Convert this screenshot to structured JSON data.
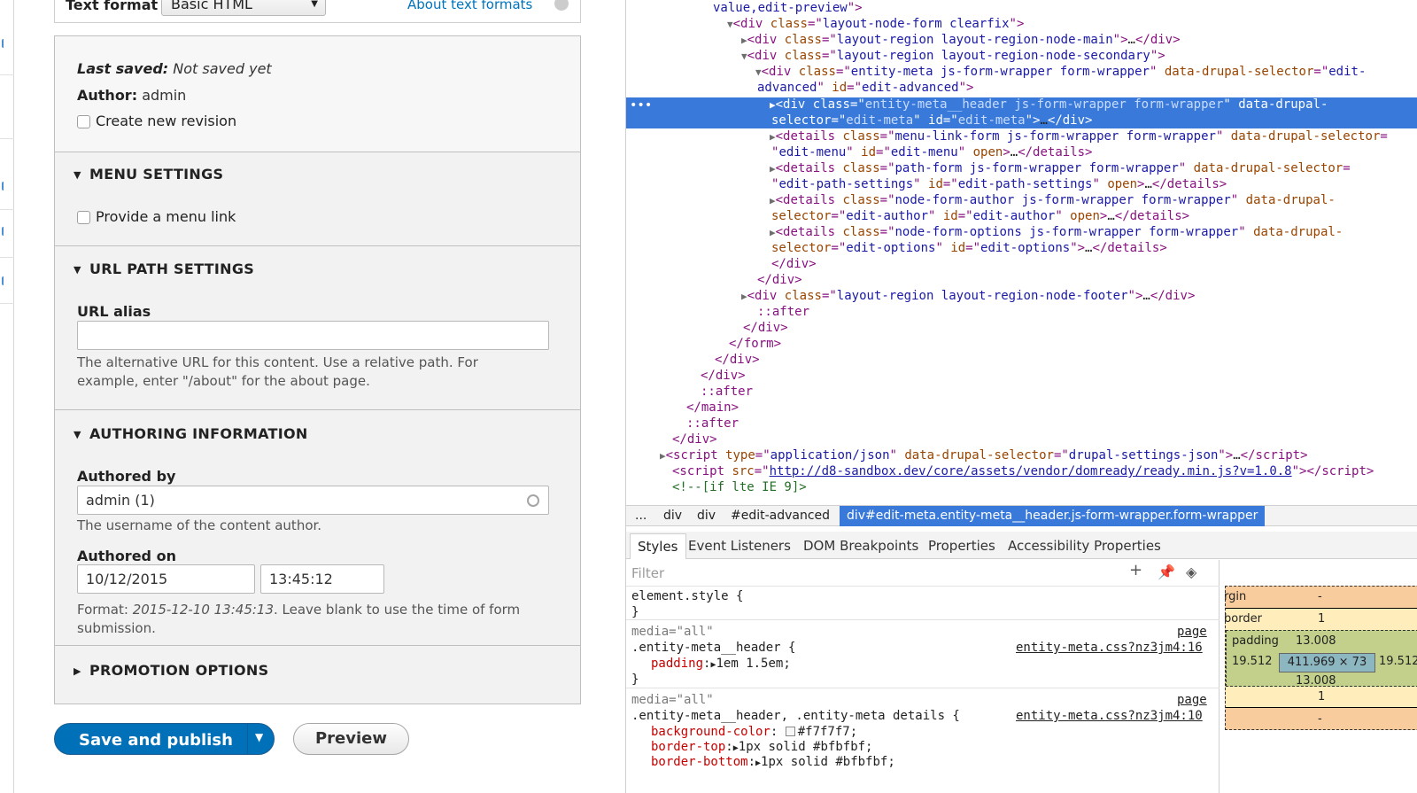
{
  "drupal": {
    "text_format": {
      "label": "Text format",
      "value": "Basic HTML",
      "help_link": "About text formats"
    },
    "meta": {
      "last_saved_label": "Last saved:",
      "last_saved_value": "Not saved yet",
      "author_label": "Author:",
      "author_value": "admin",
      "revision_checkbox": "Create new revision"
    },
    "menu_settings": {
      "title": "MENU SETTINGS",
      "checkbox": "Provide a menu link"
    },
    "url_path": {
      "title": "URL PATH SETTINGS",
      "field_label": "URL alias",
      "value": "",
      "desc_line1": "The alternative URL for this content. Use a relative path. For",
      "desc_line2": "example, enter \"/about\" for the about page."
    },
    "authoring": {
      "title": "AUTHORING INFORMATION",
      "authored_by_label": "Authored by",
      "authored_by_value": "admin (1)",
      "authored_by_desc": "The username of the content author.",
      "authored_on_label": "Authored on",
      "date_value": "10/12/2015",
      "time_value": "13:45:12",
      "format_prefix": "Format: ",
      "format_example": "2015-12-10 13:45:13",
      "format_suffix": ". Leave blank to use the time of form",
      "format_line2": "submission."
    },
    "promotion": {
      "title": "PROMOTION OPTIONS"
    },
    "actions": {
      "save": "Save and publish",
      "preview": "Preview"
    }
  },
  "devtools": {
    "breadcrumbs": [
      "...",
      "div",
      "div",
      "#edit-advanced"
    ],
    "breadcrumb_active": "div#edit-meta.entity-meta__header.js-form-wrapper.form-wrapper",
    "tabs": [
      "Styles",
      "Event Listeners",
      "DOM Breakpoints",
      "Properties",
      "Accessibility Properties"
    ],
    "filter_placeholder": "Filter",
    "rules": [
      {
        "media": "",
        "selector": "element.style {",
        "source": "",
        "props": []
      },
      {
        "media": "media=\"all\"",
        "selector": ".entity-meta__header {",
        "source_top": "page",
        "source": "entity-meta.css?nz3jm4:16",
        "props": [
          {
            "name": "padding",
            "value": "1em 1.5em;"
          }
        ]
      },
      {
        "media": "media=\"all\"",
        "selector": ".entity-meta__header, .entity-meta details {",
        "source_top": "page",
        "source": "entity-meta.css?nz3jm4:10",
        "props": [
          {
            "name": "background-color",
            "value": "#f7f7f7;"
          },
          {
            "name": "border-top",
            "value": "1px solid #bfbfbf;"
          },
          {
            "name": "border-bottom",
            "value": "1px solid #bfbfbf;"
          }
        ]
      }
    ],
    "box_model": {
      "margin_label": "rgin",
      "margin_value": "-",
      "border_label": "border",
      "border_value": "1",
      "padding_label": "padding",
      "padding_top": "13.008",
      "padding_left": "19.512",
      "padding_right": "19.512",
      "padding_bottom": "13.008",
      "content": "411.969 × 73",
      "border_bottom": "1",
      "margin_bottom": "-"
    },
    "colors": {
      "selection": "#3879d9",
      "margin": "#f9cc9d",
      "border": "#ffeebc",
      "padding": "#c3d08b",
      "content": "#8cb6c0"
    }
  }
}
